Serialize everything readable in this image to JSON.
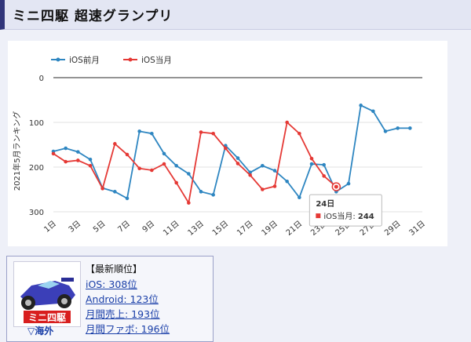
{
  "page": {
    "title": "ミニ四駆 超速グランプリ"
  },
  "chart_data": {
    "type": "line",
    "ylabel": "2021年5月ランキング",
    "ylim": [
      300,
      0
    ],
    "y_inverted": true,
    "yticks": [
      0,
      100,
      200,
      300
    ],
    "x_tick_labels": [
      "1日",
      "3日",
      "5日",
      "7日",
      "9日",
      "11日",
      "13日",
      "15日",
      "17日",
      "19日",
      "21日",
      "23日",
      "25日",
      "27日",
      "29日",
      "31日"
    ],
    "x_days": [
      1,
      3,
      5,
      7,
      9,
      11,
      13,
      15,
      17,
      19,
      21,
      23,
      25,
      27,
      29,
      31
    ],
    "legend_position": "top-left",
    "series": [
      {
        "name": "iOS前月",
        "color": "#2e86c1",
        "days": [
          1,
          2,
          3,
          4,
          5,
          6,
          7,
          8,
          9,
          10,
          11,
          12,
          13,
          14,
          15,
          16,
          17,
          18,
          19,
          20,
          21,
          22,
          23,
          24,
          25,
          26,
          27,
          28,
          29,
          30
        ],
        "values": [
          165,
          158,
          166,
          183,
          247,
          255,
          270,
          120,
          125,
          170,
          197,
          215,
          255,
          262,
          152,
          180,
          212,
          197,
          208,
          232,
          268,
          193,
          195,
          255,
          237,
          62,
          75,
          120,
          113,
          113
        ]
      },
      {
        "name": "iOS当月",
        "color": "#e53935",
        "days": [
          1,
          2,
          3,
          4,
          5,
          6,
          7,
          8,
          9,
          10,
          11,
          12,
          13,
          14,
          15,
          16,
          17,
          18,
          19,
          20,
          21,
          22,
          23,
          24
        ],
        "values": [
          170,
          188,
          185,
          197,
          248,
          148,
          172,
          203,
          207,
          193,
          235,
          280,
          122,
          125,
          158,
          192,
          218,
          250,
          243,
          100,
          125,
          181,
          220,
          244
        ]
      }
    ],
    "tooltip": {
      "title": "24日",
      "series_label": "iOS当月:",
      "value": "244",
      "day": 24,
      "series_index": 1
    }
  },
  "info": {
    "heading": "【最新順位】",
    "items": [
      "iOS: 308位",
      "Android: 123位",
      "月間売上: 193位",
      "月間ファボ: 196位"
    ],
    "thumb_link": "▽海外"
  }
}
